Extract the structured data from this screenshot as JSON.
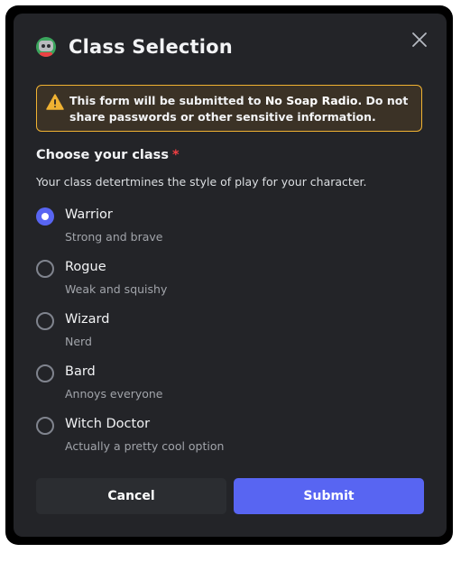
{
  "modal": {
    "title": "Class Selection",
    "close_icon": "close-icon",
    "app_icon": "robot-avatar-icon"
  },
  "warning": {
    "icon": "warning-icon",
    "text_prefix": "This form will be submitted to ",
    "app_name": "No Soap Radio",
    "text_suffix": ". Do not share passwords or other sensitive information."
  },
  "field": {
    "label": "Choose your class",
    "required_marker": "*",
    "description": "Your class detertmines the style of play for your character.",
    "options": [
      {
        "label": "Warrior",
        "description": "Strong and brave",
        "selected": true
      },
      {
        "label": "Rogue",
        "description": "Weak and squishy",
        "selected": false
      },
      {
        "label": "Wizard",
        "description": "Nerd",
        "selected": false
      },
      {
        "label": "Bard",
        "description": "Annoys everyone",
        "selected": false
      },
      {
        "label": "Witch Doctor",
        "description": "Actually a pretty cool option",
        "selected": false
      }
    ]
  },
  "actions": {
    "cancel_label": "Cancel",
    "submit_label": "Submit"
  },
  "colors": {
    "accent": "#5865f2",
    "warning_border": "#f0b232",
    "required": "#f23f43",
    "background": "#232428"
  }
}
